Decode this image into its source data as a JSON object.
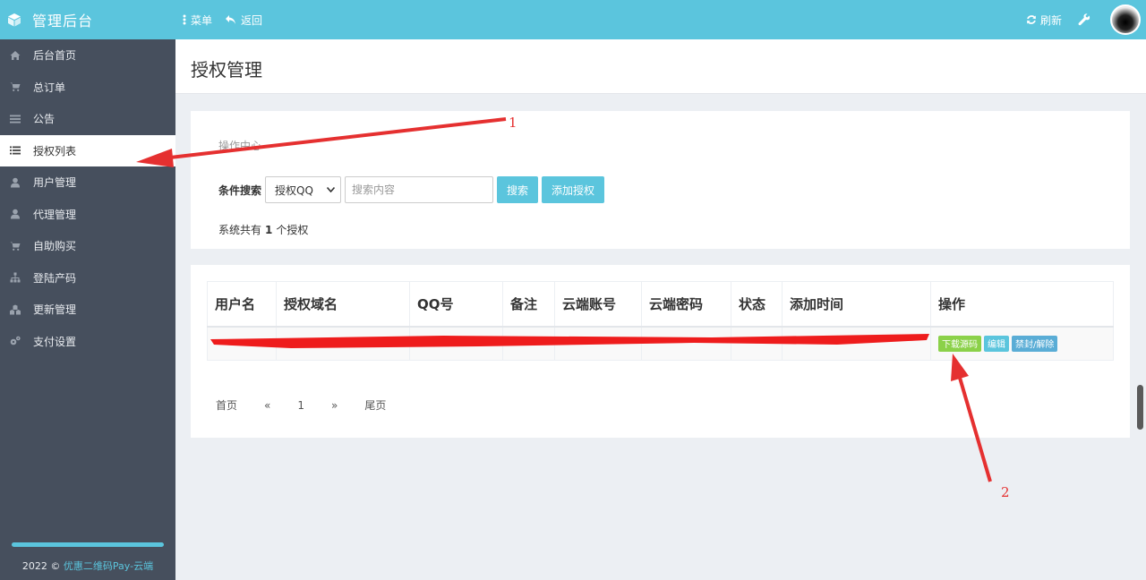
{
  "app": {
    "title": "管理后台"
  },
  "topnav": {
    "menu": "菜单",
    "back": "返回",
    "refresh": "刷新"
  },
  "sidebar": {
    "items": [
      {
        "label": "后台首页",
        "icon": "home-icon"
      },
      {
        "label": "总订单",
        "icon": "cart-icon"
      },
      {
        "label": "公告",
        "icon": "list-icon"
      },
      {
        "label": "授权列表",
        "icon": "list-icon",
        "active": true
      },
      {
        "label": "用户管理",
        "icon": "user-icon"
      },
      {
        "label": "代理管理",
        "icon": "user-icon"
      },
      {
        "label": "自助购买",
        "icon": "cart-icon"
      },
      {
        "label": "登陆产码",
        "icon": "sitemap-icon"
      },
      {
        "label": "更新管理",
        "icon": "cubes-icon"
      },
      {
        "label": "支付设置",
        "icon": "gears-icon"
      }
    ],
    "footer_year": "2022 ©",
    "footer_link": "优惠二维码Pay-云端"
  },
  "page": {
    "title": "授权管理"
  },
  "operations": {
    "section_title": "操作中心",
    "search_label": "条件搜索",
    "select_value": "授权QQ",
    "search_placeholder": "搜索内容",
    "search_button": "搜索",
    "add_button": "添加授权",
    "count_prefix": "系统共有",
    "count": "1",
    "count_suffix": "个授权"
  },
  "table": {
    "headers": [
      "用户名",
      "授权域名",
      "QQ号",
      "备注",
      "云端账号",
      "云端密码",
      "状态",
      "添加时间",
      "操作"
    ],
    "row_actions": {
      "download": "下载源码",
      "edit": "编辑",
      "ban": "禁封/解除"
    }
  },
  "pagination": {
    "first": "首页",
    "prev": "«",
    "page": "1",
    "next": "»",
    "last": "尾页"
  },
  "annotations": {
    "n1": "1",
    "n2": "2"
  },
  "colors": {
    "accent": "#5bc5dd",
    "sidebar": "#464f5d",
    "annotation": "#e53030",
    "download": "#8bd149"
  }
}
